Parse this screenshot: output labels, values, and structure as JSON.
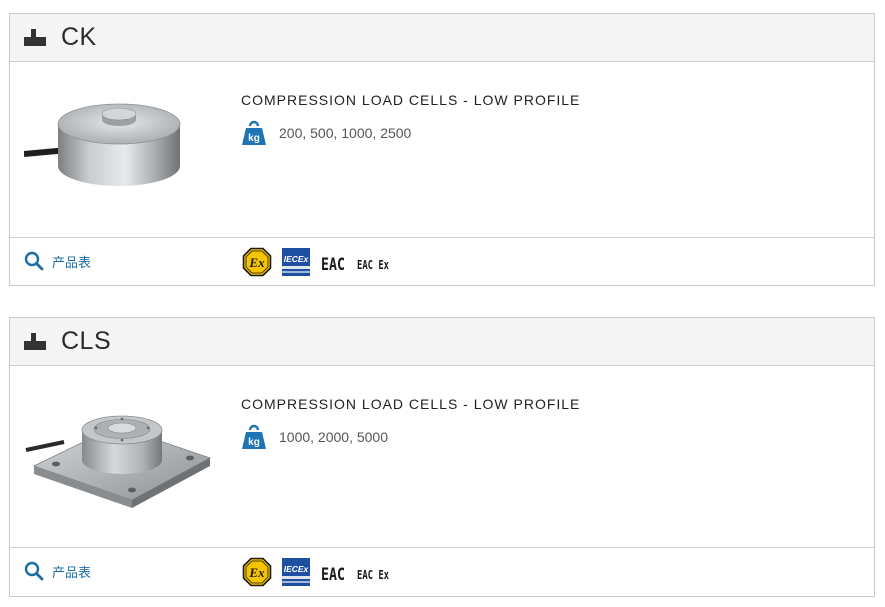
{
  "products": [
    {
      "name": "CK",
      "type": "COMPRESSION LOAD CELLS - LOW PROFILE",
      "capacities": "200, 500, 1000, 2500",
      "datasheet_label": "产品表",
      "certifications": {
        "atex": "Ex",
        "iecex": "IECEx",
        "eac": "EAC",
        "eac_ex": "EAC Ex"
      },
      "icons": {
        "header": "load-cell-icon",
        "capacity": "kg-weight-icon",
        "datasheet": "search-icon"
      }
    },
    {
      "name": "CLS",
      "type": "COMPRESSION LOAD CELLS - LOW PROFILE",
      "capacities": "1000, 2000, 5000",
      "datasheet_label": "产品表",
      "certifications": {
        "atex": "Ex",
        "iecex": "IECEx",
        "eac": "EAC",
        "eac_ex": "EAC Ex"
      },
      "icons": {
        "header": "load-cell-icon",
        "capacity": "kg-weight-icon",
        "datasheet": "search-icon"
      }
    }
  ],
  "colors": {
    "accent_blue": "#1a6ea5",
    "kg_icon_blue": "#1e75b5",
    "atex_yellow": "#f5c400",
    "iecex_blue": "#1f4fa0",
    "header_bg": "#f5f5f5"
  }
}
